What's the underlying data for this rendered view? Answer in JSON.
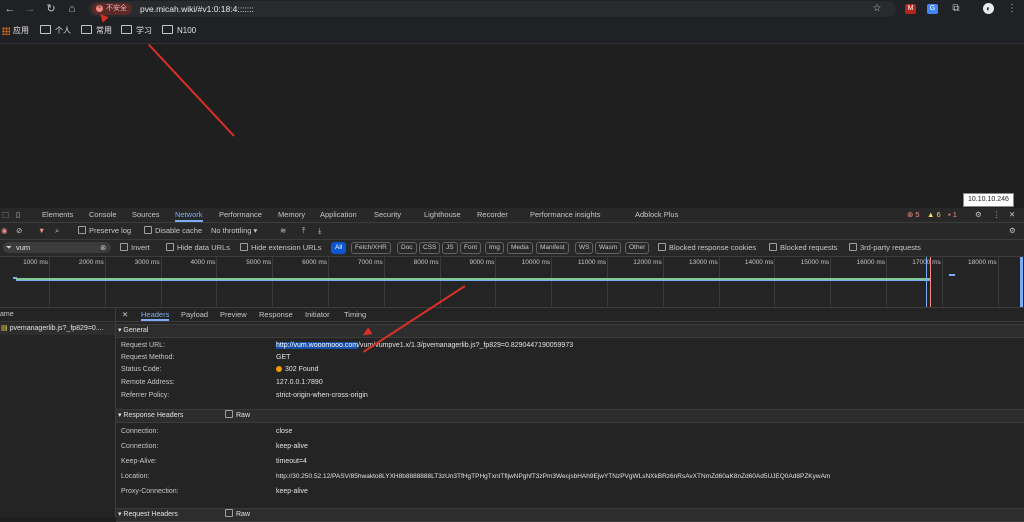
{
  "browser": {
    "security_label": "不安全",
    "url": "pve.micah.wiki/#v1:0:18:4:::::::"
  },
  "bookmarks": [
    {
      "label": "应用"
    },
    {
      "label": "个人"
    },
    {
      "label": "常用"
    },
    {
      "label": "学习"
    },
    {
      "label": "N100"
    }
  ],
  "tooltip": "10.10.10.246",
  "devtools": {
    "tabs": [
      "Elements",
      "Console",
      "Sources",
      "Network",
      "Performance",
      "Memory",
      "Application",
      "Security",
      "Lighthouse",
      "Recorder",
      "Performance insights",
      "Adblock Plus"
    ],
    "active_tab": "Network",
    "errors": "5",
    "warnings": "6",
    "issues": "1",
    "preserve_log": "Preserve log",
    "disable_cache": "Disable cache",
    "throttling": "No throttling",
    "filter_value": "vum",
    "invert": "Invert",
    "hide_data_urls": "Hide data URLs",
    "hide_ext_urls": "Hide extension URLs",
    "type_chips": [
      "All",
      "Fetch/XHR",
      "Doc",
      "CSS",
      "JS",
      "Font",
      "Img",
      "Media",
      "Manifest",
      "WS",
      "Wasm",
      "Other"
    ],
    "blocked_cookies": "Blocked response cookies",
    "blocked_requests": "Blocked requests",
    "third_party": "3rd-party requests",
    "timeline_ticks": [
      "1000 ms",
      "2000 ms",
      "3000 ms",
      "4000 ms",
      "5000 ms",
      "6000 ms",
      "7000 ms",
      "8000 ms",
      "9000 ms",
      "10000 ms",
      "11000 ms",
      "12000 ms",
      "13000 ms",
      "14000 ms",
      "15000 ms",
      "16000 ms",
      "17000 ms",
      "18000 ms"
    ],
    "list_header": "ame",
    "request_name": "pvemanagerlib.js?_fp829=0....",
    "detail_tabs": [
      "Headers",
      "Payload",
      "Preview",
      "Response",
      "Initiator",
      "Timing"
    ],
    "general_title": "General",
    "general": [
      {
        "key": "Request URL:",
        "val_host": "http://vum.wooomooo.com",
        "val_rest": "/vum/vumpve1.x/1.3/pvemanagerlib.js?_fp829=0.8290447190059973"
      },
      {
        "key": "Request Method:",
        "val": "GET"
      },
      {
        "key": "Status Code:",
        "val": "302 Found"
      },
      {
        "key": "Remote Address:",
        "val": "127.0.0.1:7890"
      },
      {
        "key": "Referrer Policy:",
        "val": "strict-origin-when-cross-origin"
      }
    ],
    "response_headers_title": "Response Headers",
    "raw_label": "Raw",
    "response_headers": [
      {
        "key": "Connection:",
        "val": "close"
      },
      {
        "key": "Connection:",
        "val": "keep-alive"
      },
      {
        "key": "Keep-Alive:",
        "val": "timeout=4"
      },
      {
        "key": "Location:",
        "val": "http://30.250.52.12/PASV/85hwakto8LYXH8b8888888LT3zUn3TfHgTPHgTxntTfljwNPghfT3zPm3WecjsbHAh9EjwYTNzPVgWLsNXkBRz6nRsAvXTNmZd60aK8nZd60Ad5UJEQ0Ad8PZKywAm"
      },
      {
        "key": "Proxy-Connection:",
        "val": "keep-alive"
      }
    ],
    "request_headers_title": "Request Headers"
  }
}
